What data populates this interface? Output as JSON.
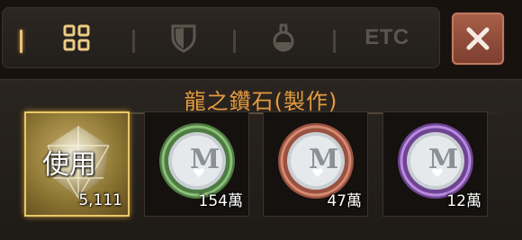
{
  "tabs": [
    {
      "name": "all",
      "icon": "grid-icon"
    },
    {
      "name": "equipment",
      "icon": "shield-icon"
    },
    {
      "name": "consumable",
      "icon": "potion-icon"
    },
    {
      "name": "etc",
      "label": "ETC"
    }
  ],
  "close_icon": "close-icon",
  "panel": {
    "title": "龍之鑽石(製作)"
  },
  "items": [
    {
      "label": "使用",
      "count": "5,111",
      "icon": "diamond-icon",
      "selected": true
    },
    {
      "count": "154萬",
      "icon": "green-coin-icon",
      "ring_color": "#5f9a4e"
    },
    {
      "count": "47萬",
      "icon": "red-coin-icon",
      "ring_color": "#b56750"
    },
    {
      "count": "12萬",
      "icon": "purple-coin-icon",
      "ring_color": "#8d58b8"
    }
  ],
  "colors": {
    "accent_gold": "#e7c37a",
    "title_orange": "#e59a3e",
    "close_red": "#a9604a"
  }
}
